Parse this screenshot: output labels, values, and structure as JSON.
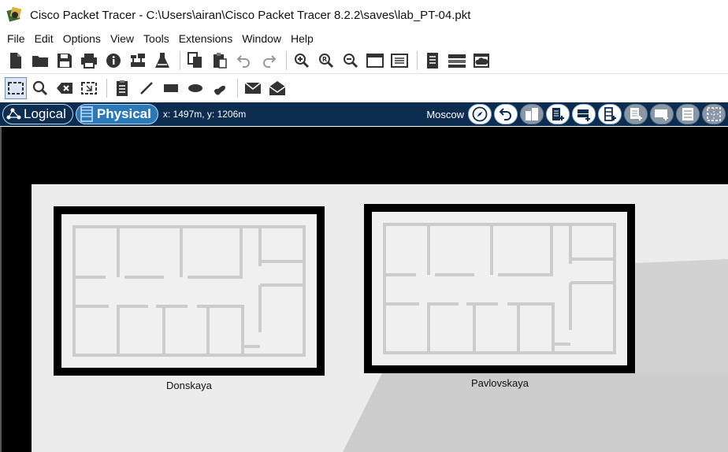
{
  "window": {
    "title": "Cisco Packet Tracer - C:\\Users\\airan\\Cisco Packet Tracer 8.2.2\\saves\\lab_PT-04.pkt"
  },
  "menu": [
    "File",
    "Edit",
    "Options",
    "View",
    "Tools",
    "Extensions",
    "Window",
    "Help"
  ],
  "modebar": {
    "logical_label": "Logical",
    "physical_label": "Physical",
    "coords": "x: 1497m, y: 1206m",
    "location": "Moscow"
  },
  "buildings": [
    {
      "name": "Donskaya"
    },
    {
      "name": "Pavlovskaya"
    }
  ],
  "colors": {
    "modebar_bg": "#0c2d4f",
    "physical_tab": "#2c79b8",
    "canvas_bg": "#000000",
    "floor_bg": "#ececec"
  }
}
